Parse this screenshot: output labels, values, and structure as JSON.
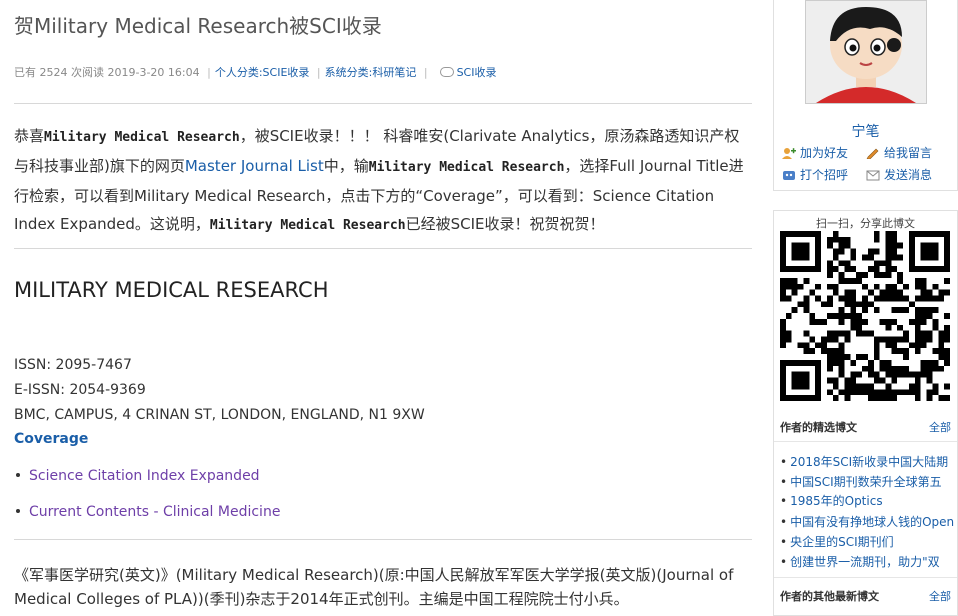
{
  "article": {
    "title": "贺Military Medical Research被SCI收录",
    "meta": {
      "reads_prefix": "已有",
      "reads": "2524",
      "reads_suffix": "次阅读",
      "date": "2019-3-20 16:04",
      "personal_category": "个人分类:SCIE收录",
      "system_category": "系统分类:科研笔记",
      "tag": "SCI收录"
    },
    "para1": {
      "t1": "恭喜",
      "b1": "Military Medical Research",
      "t2": "，被SCIE收录！！！ 科睿唯安(Clarivate Analytics，原汤森路透知识产权与科技事业部)旗下的网页",
      "link": "Master Journal List",
      "t3": "中，输",
      "b2": "Military Medical Research",
      "t4": "，选择Full Journal Title进行检索，可以看到Military Medical Research，点击下方的“Coverage”，可以看到：Science Citation Index Expanded。这说明，",
      "b3": "Military Medical Research",
      "t5": "已经被SCIE收录！祝贺祝贺！"
    },
    "journal_heading": "MILITARY MEDICAL RESEARCH",
    "issn": "ISSN: 2095-7467",
    "eissn": "E-ISSN: 2054-9369",
    "address": "BMC, CAMPUS, 4 CRINAN ST, LONDON, ENGLAND, N1 9XW",
    "coverage_label": "Coverage",
    "coverage_items": [
      "Science Citation Index Expanded",
      "Current Contents - Clinical Medicine"
    ],
    "para2": "《军事医学研究(英文)》(Military Medical Research)(原:中国人民解放军军医大学学报(英文版)(Journal of Medical Colleges of PLA))(季刊)杂志于2014年正式创刊。主编是中国工程院院士付小兵。"
  },
  "sidebar": {
    "username": "宁笔",
    "actions": {
      "add_friend": "加为好友",
      "leave_message": "给我留言",
      "greet": "打个招呼",
      "send_message": "发送消息"
    },
    "qr_caption": "扫一扫，分享此博文",
    "featured": {
      "title": "作者的精选博文",
      "all": "全部",
      "posts": [
        "2018年SCI新收录中国大陆期",
        "中国SCI期刊数荣升全球第五",
        "1985年的Optics",
        "中国有没有挣地球人钱的Open",
        "央企里的SCI期刊们",
        "创建世界一流期刊，助力\"双"
      ]
    },
    "latest": {
      "title": "作者的其他最新博文",
      "all": "全部"
    }
  },
  "colors": {
    "link": "#1a5ea8",
    "visited_link": "#6e3fa8",
    "border": "#e0e0e0"
  },
  "icons": [
    "tag-icon",
    "add-friend-icon",
    "message-pencil-icon",
    "greet-icon",
    "mail-icon",
    "qr-code"
  ]
}
